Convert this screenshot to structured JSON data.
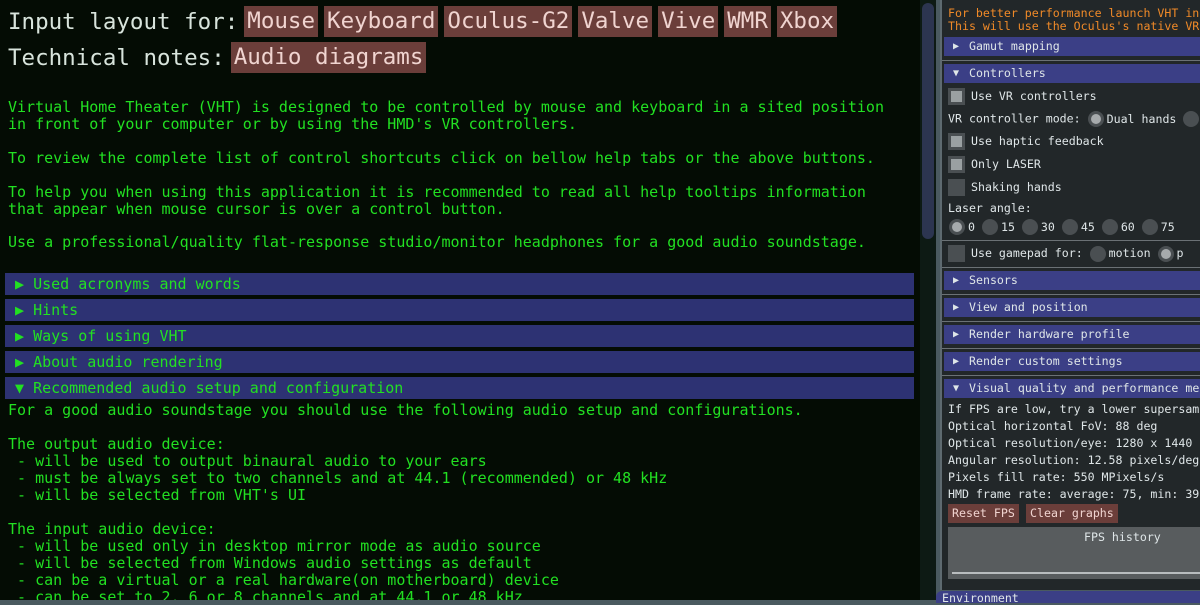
{
  "header": {
    "input_layout_label": "Input layout for:",
    "input_buttons": [
      "Mouse",
      "Keyboard",
      "Oculus-G2",
      "Valve",
      "Vive",
      "WMR",
      "Xbox"
    ],
    "technical_label": "Technical notes:",
    "technical_buttons": [
      "Audio diagrams"
    ]
  },
  "intro": [
    "Virtual Home Theater (VHT) is designed to be controlled by mouse and keyboard in a sited position\nin front of your computer or by using the HMD's VR controllers.",
    "To review the complete list of control shortcuts click on bellow help tabs or the above buttons.",
    "To help you when using this application it is recommended to read all help tooltips information\nthat appear when mouse cursor is over a control button.",
    "Use a professional/quality flat-response studio/monitor headphones for a good audio soundstage."
  ],
  "help_sections": [
    {
      "label": "Used acronyms and words",
      "expanded": false
    },
    {
      "label": "Hints",
      "expanded": false
    },
    {
      "label": "Ways of using VHT",
      "expanded": false
    },
    {
      "label": "About audio rendering",
      "expanded": false
    },
    {
      "label": "Recommended audio setup and configuration",
      "expanded": true
    }
  ],
  "recommended_text": "For a good audio soundstage you should use the following audio setup and configurations.\n\nThe output audio device:\n - will be used to output binaural audio to your ears\n - must be always set to two channels and at 44.1 (recommended) or 48 kHz\n - will be selected from VHT's UI\n\nThe input audio device:\n - will be used only in desktop mirror mode as audio source\n - will be selected from Windows audio settings as default\n - can be a virtual or a real hardware(on motherboard) device\n - can be set to 2, 6 or 8 channels and at 44.1 or 48 kHz",
  "right_panel": {
    "warning": [
      "For better performance launch VHT in",
      "This will use the Oculus's native VR"
    ],
    "sections": {
      "gamut": "Gamut mapping",
      "controllers": "Controllers",
      "sensors": "Sensors",
      "view": "View and position",
      "render_hw": "Render hardware profile",
      "render_custom": "Render custom settings",
      "visual": "Visual quality and performance me"
    },
    "controllers": {
      "use_vr": {
        "label": "Use VR controllers",
        "checked": true
      },
      "mode_label": "VR controller mode:",
      "mode_options": [
        "Dual hands"
      ],
      "mode_selected": "Dual hands",
      "haptic": {
        "label": "Use haptic feedback",
        "checked": true
      },
      "only_laser": {
        "label": "Only LASER",
        "checked": true
      },
      "shaking": {
        "label": "Shaking hands",
        "checked": false
      },
      "laser_angle_label": "Laser angle:",
      "laser_angles": [
        "0",
        "15",
        "30",
        "45",
        "60",
        "75"
      ],
      "laser_selected": "0",
      "gamepad_label": "Use gamepad for:",
      "gamepad_checked": false,
      "gamepad_options": [
        "motion",
        "p"
      ],
      "gamepad_selected": "p"
    },
    "visual": {
      "lines": [
        "If FPS are low, try a lower supersamp",
        "Optical horizontal FoV: 88 deg",
        "Optical resolution/eye: 1280 x 1440",
        "Angular resolution: 12.58 pixels/deg",
        "Pixels fill rate: 550 MPixels/s",
        "HMD frame rate: average: 75, min: 39,"
      ],
      "reset_fps": "Reset FPS",
      "clear_graphs": "Clear graphs",
      "graph_title": "FPS history"
    },
    "bottom_title": "Environment"
  },
  "colors": {
    "text_green": "#22e022",
    "section_bg": "#2d3273",
    "button_bg": "#6b3e3a",
    "warning": "#f08a28"
  }
}
